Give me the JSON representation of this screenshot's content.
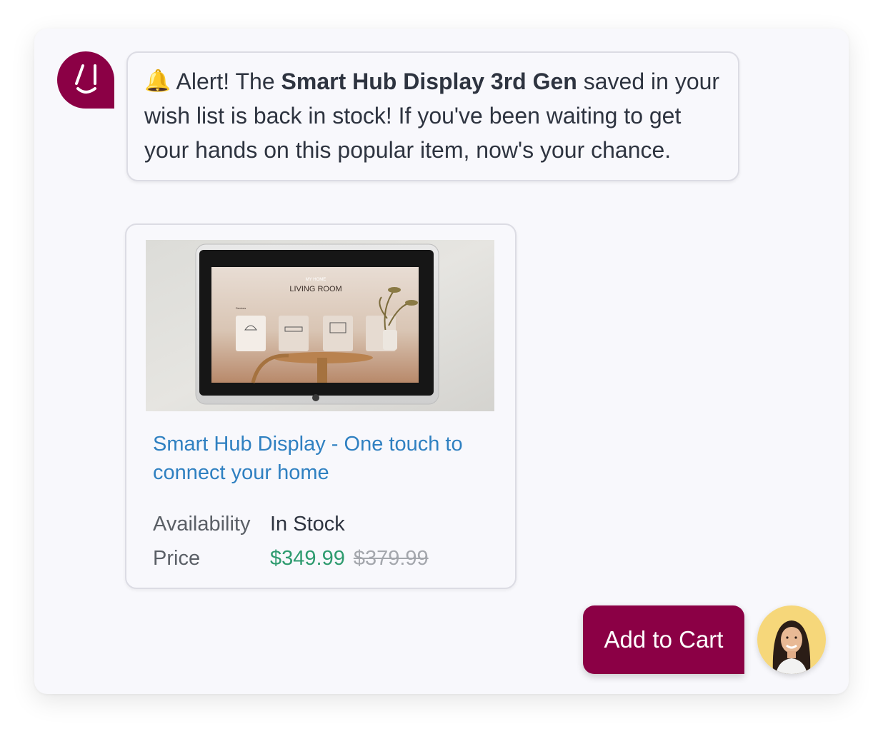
{
  "bot": {
    "avatar_text": "AI"
  },
  "message": {
    "bell_icon": "🔔",
    "text_before": " Alert! The ",
    "product_name_bold": "Smart Hub Display 3rd Gen",
    "text_after": " saved in your wish list is back in stock! If you've been waiting to get your hands on this popular item, now's your chance."
  },
  "product": {
    "screen_subtitle": "MY HOME",
    "screen_title": "LIVING ROOM",
    "screen_devices_label": "Devices",
    "title": "Smart Hub Display - One touch to connect your home",
    "availability_label": "Availability",
    "availability_value": "In Stock",
    "price_label": "Price",
    "price_current": "$349.99",
    "price_original": "$379.99"
  },
  "actions": {
    "add_to_cart_label": "Add to Cart"
  },
  "colors": {
    "brand": "#8b0045",
    "link": "#2f80c1",
    "price_current": "#2e9b6f",
    "price_original": "#a4a7ad"
  }
}
